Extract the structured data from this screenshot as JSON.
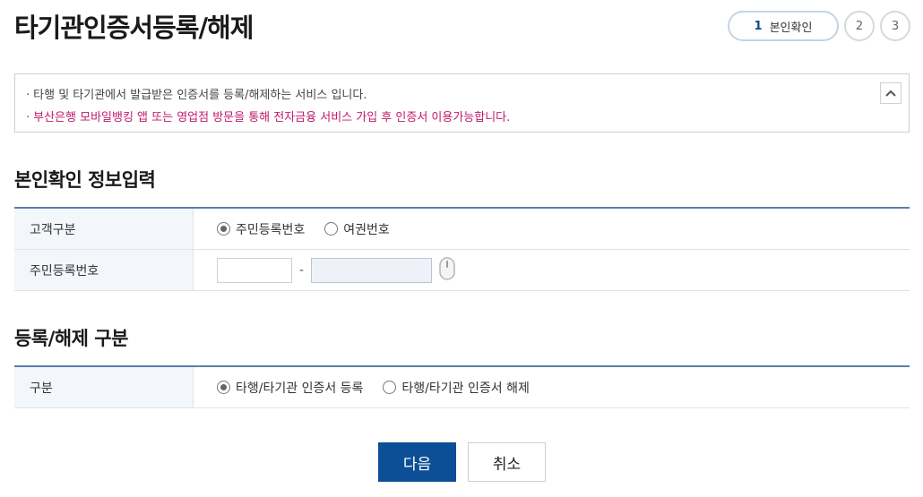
{
  "page": {
    "title": "타기관인증서등록/해제"
  },
  "steps": {
    "active_num": "1",
    "active_label": "본인확인",
    "step2": "2",
    "step3": "3"
  },
  "notice": {
    "line1": "타행 및 타기관에서 발급받은 인증서를 등록/해제하는 서비스 입니다.",
    "line2": "부산은행 모바일뱅킹 앱 또는 영업점 방문을 통해 전자금융 서비스 가입 후 인증서 이용가능합니다.",
    "bullet": "·"
  },
  "identity": {
    "section_title": "본인확인 정보입력",
    "customer_type_label": "고객구분",
    "option_rrn": "주민등록번호",
    "option_passport": "여권번호",
    "selected": "주민등록번호",
    "rrn_label": "주민등록번호",
    "rrn_front": "",
    "rrn_back": "",
    "dash": "-"
  },
  "register": {
    "section_title": "등록/해제 구분",
    "type_label": "구분",
    "option_register": "타행/타기관 인증서 등록",
    "option_unregister": "타행/타기관 인증서 해제",
    "selected": "타행/타기관 인증서 등록"
  },
  "buttons": {
    "next": "다음",
    "cancel": "취소"
  },
  "colors": {
    "primary": "#0d4f96",
    "accent_pink": "#c0196b",
    "table_border": "#5b7fa8",
    "label_bg": "#f3f6fb"
  }
}
